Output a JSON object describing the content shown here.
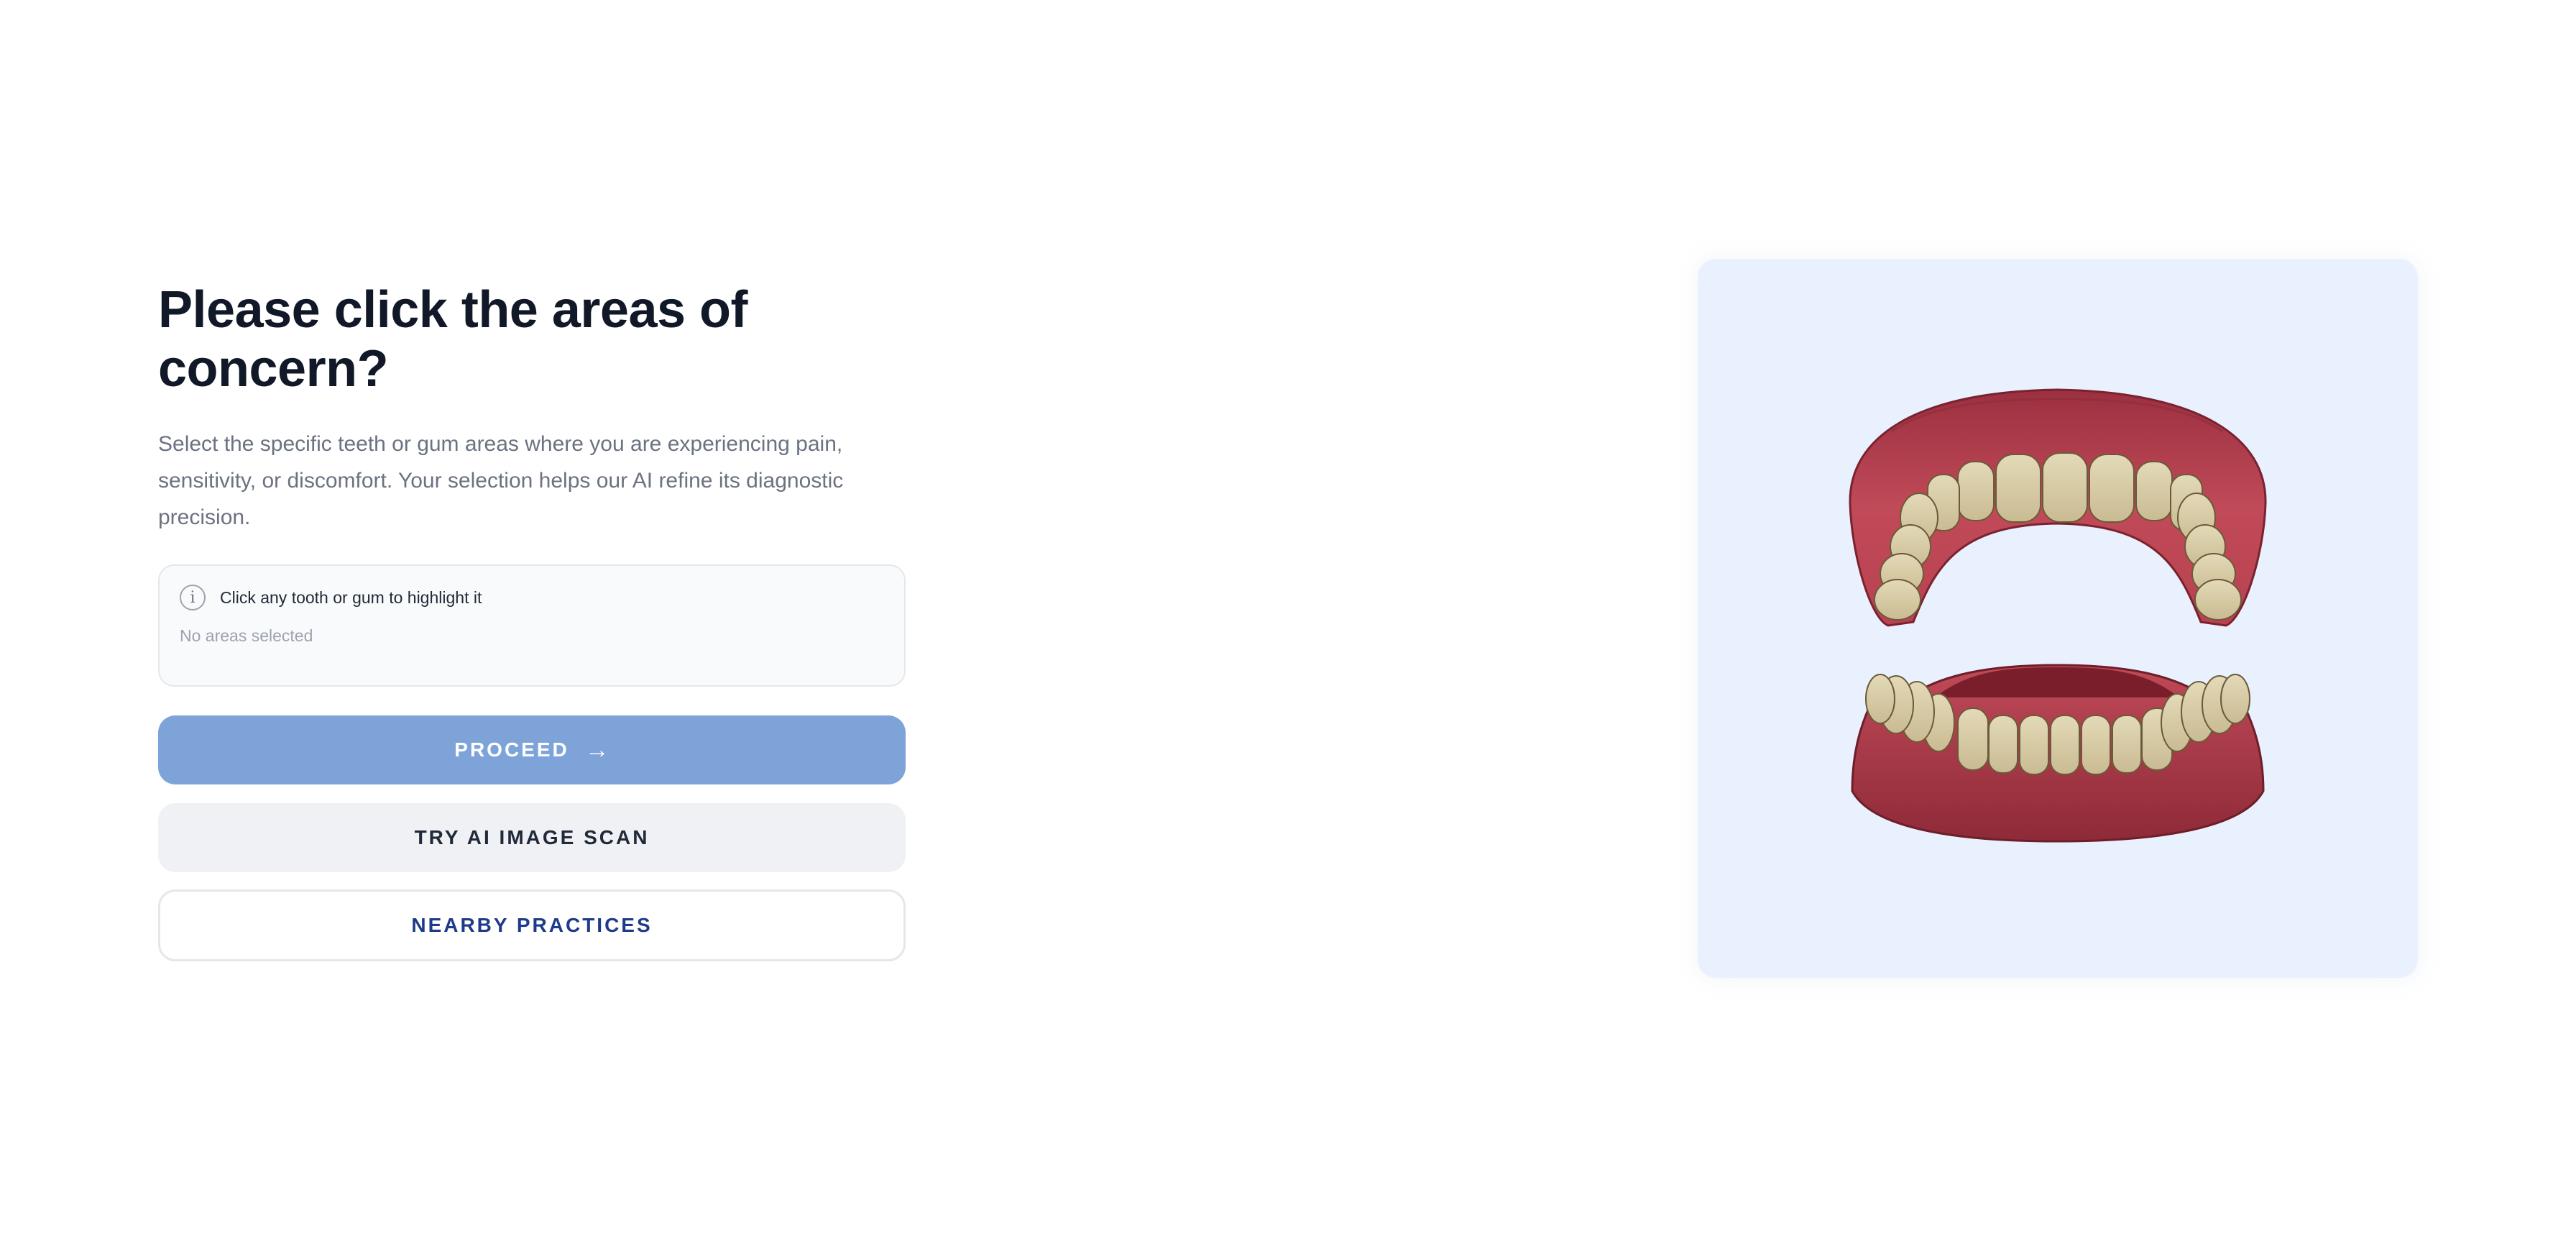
{
  "heading": "Please click the areas of concern?",
  "description": "Select the specific teeth or gum areas where you are experiencing pain, sensitivity, or discomfort. Your selection helps our AI refine its diagnostic precision.",
  "info": {
    "icon": "info-icon",
    "hint": "Click any tooth or gum to highlight it",
    "selection_status": "No areas selected"
  },
  "buttons": {
    "proceed_label": "PROCEED",
    "proceed_arrow": "→",
    "scan_label": "TRY AI IMAGE SCAN",
    "nearby_label": "NEARBY PRACTICES"
  },
  "colors": {
    "proceed_bg": "#7ea3d8",
    "panel_bg": "#eaf1fe",
    "gum": "#b0404f",
    "tooth": "#d8cca8",
    "nearby_text": "#1e3a8a"
  },
  "model": {
    "upper_arch": "upper-jaw",
    "lower_arch": "lower-jaw"
  }
}
